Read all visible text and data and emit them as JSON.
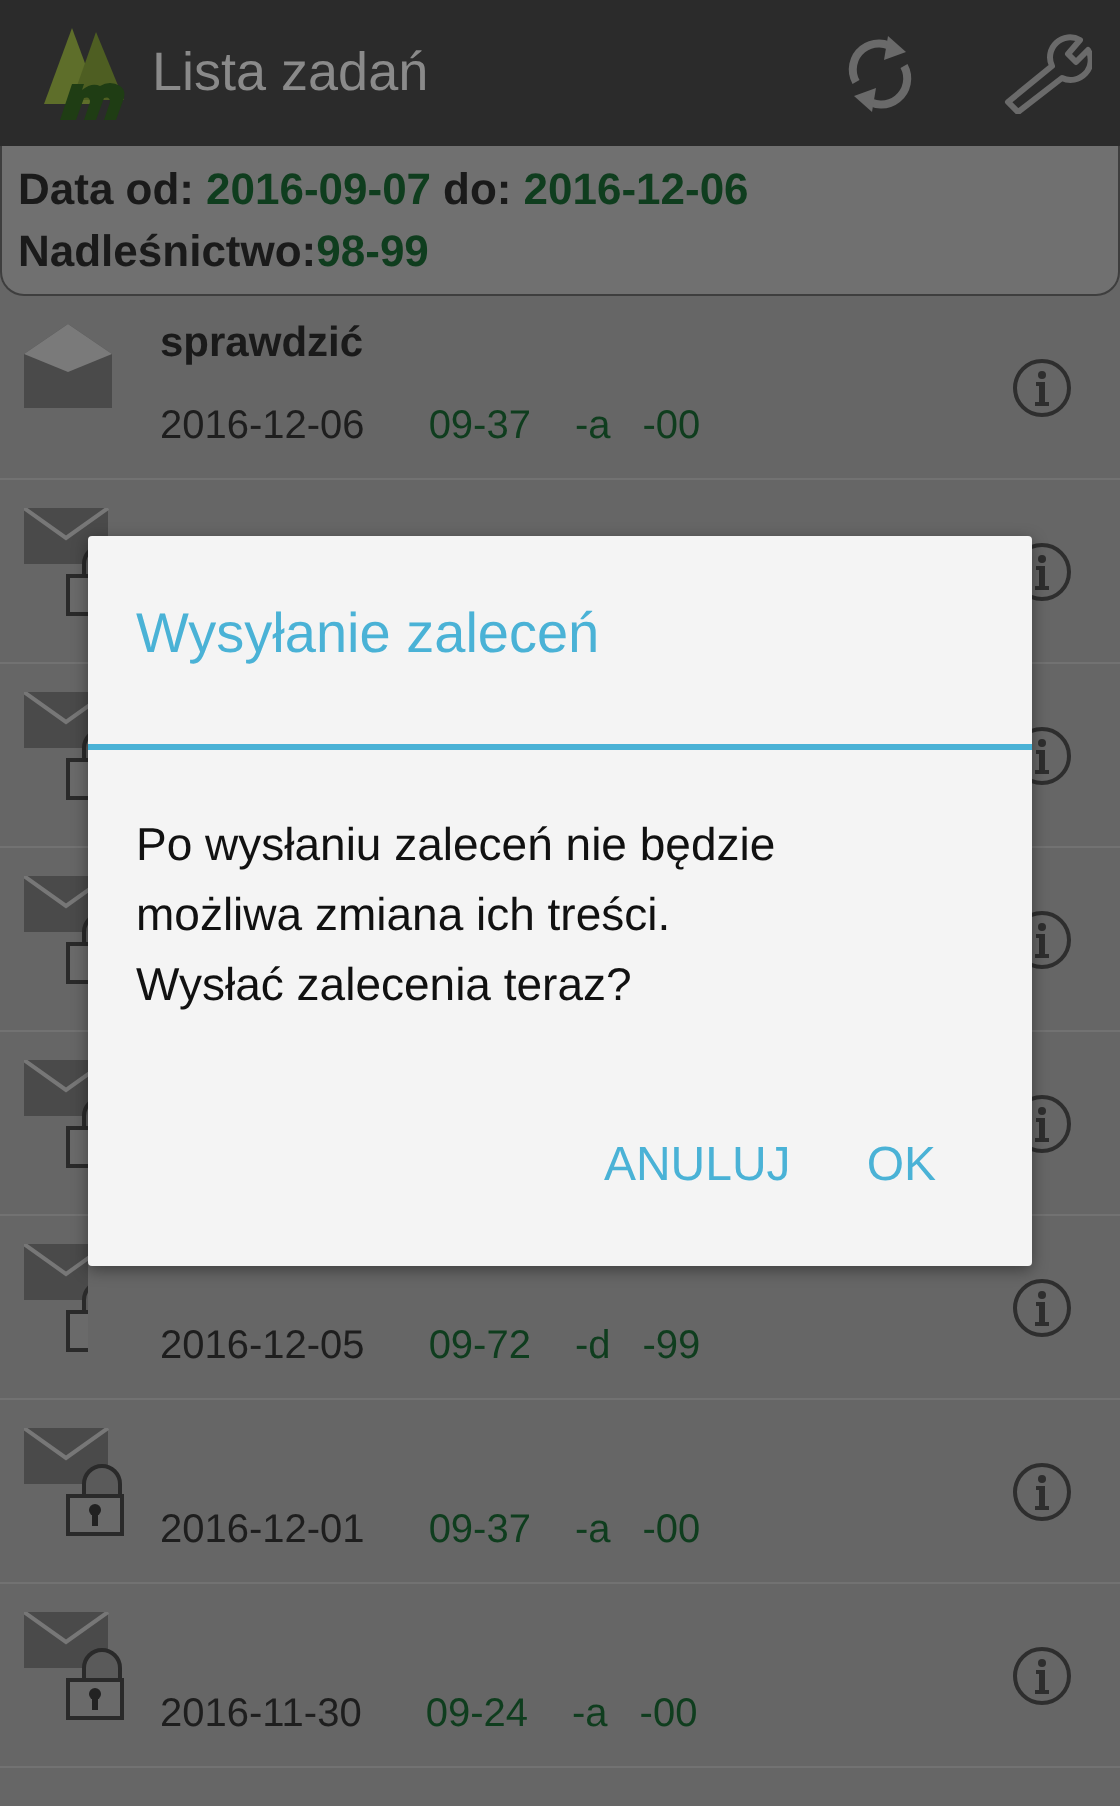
{
  "app_bar": {
    "title": "Lista zadań"
  },
  "filter": {
    "from_label": "Data od:",
    "from_value": "2016-09-07",
    "to_label": "do:",
    "to_value": "2016-12-06",
    "district_label": "Nadleśnictwo:",
    "district_value": "98-99"
  },
  "tasks": [
    {
      "kind": "opened",
      "title": "sprawdzić",
      "date": "2016-12-06",
      "code": "09-37",
      "letter": "-a",
      "number": "-00"
    },
    {
      "kind": "locked"
    },
    {
      "kind": "locked"
    },
    {
      "kind": "locked"
    },
    {
      "kind": "locked"
    },
    {
      "kind": "locked",
      "date": "2016-12-05",
      "code": "09-72",
      "letter": "-d",
      "number": "-99"
    },
    {
      "kind": "locked",
      "date": "2016-12-01",
      "code": "09-37",
      "letter": "-a",
      "number": "-00"
    },
    {
      "kind": "locked",
      "date": "2016-11-30",
      "code": "09-24",
      "letter": "-a",
      "number": "-00"
    }
  ],
  "dialog": {
    "title": "Wysyłanie zaleceń",
    "message": "Po wysłaniu zaleceń nie będzie możliwa zmiana ich treści. Wysłać zalecenia teraz?",
    "buttons": [
      "ANULUJ",
      "OK"
    ]
  }
}
